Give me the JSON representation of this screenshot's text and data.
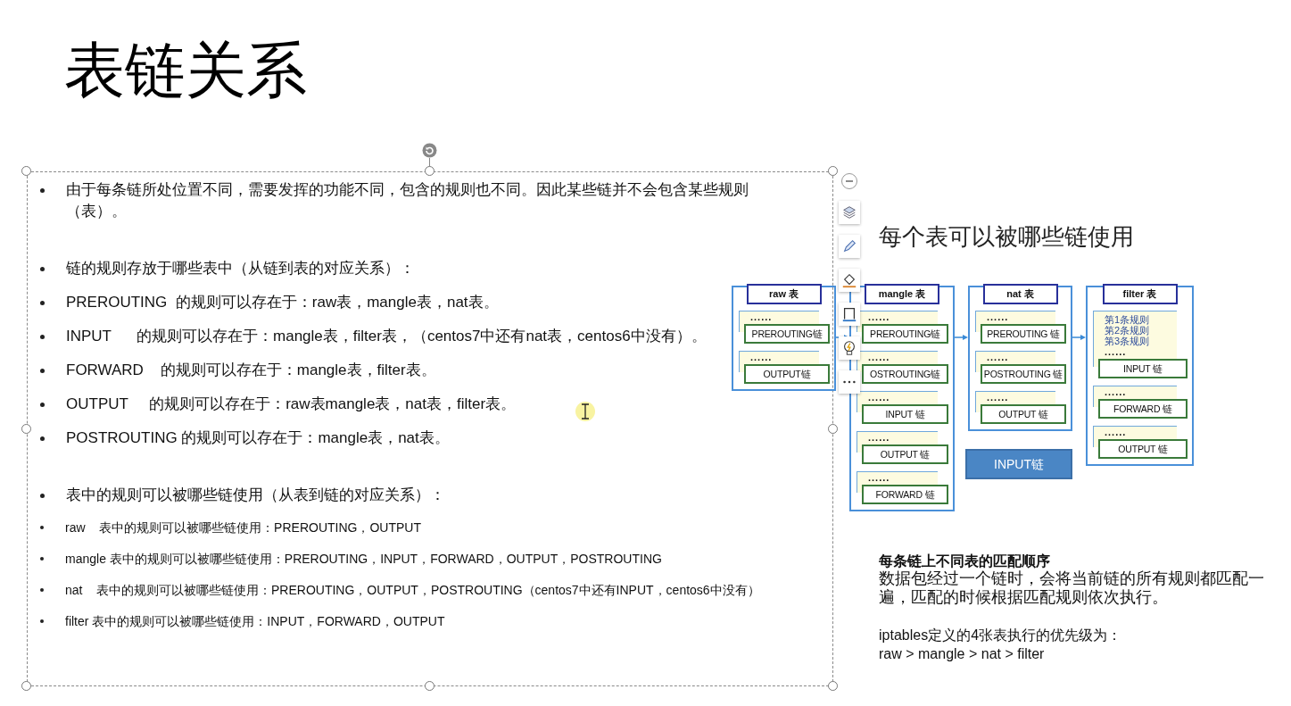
{
  "slide": {
    "title": "表链关系"
  },
  "text_box": {
    "groups": [
      [
        {
          "kind": "main",
          "text": "由于每条链所处位置不同，需要发挥的功能不同，包含的规则也不同。因此某些链并不会包含某些规则（表）。"
        }
      ],
      [
        {
          "kind": "main",
          "text": "链的规则存放于哪些表中（从链到表的对应关系）："
        },
        {
          "kind": "main",
          "text": "PREROUTING  的规则可以存在于：raw表，mangle表，nat表。"
        },
        {
          "kind": "main",
          "text": "INPUT      的规则可以存在于：mangle表，filter表，（centos7中还有nat表，centos6中没有）。"
        },
        {
          "kind": "main",
          "text": "FORWARD    的规则可以存在于：mangle表，filter表。"
        },
        {
          "kind": "main",
          "text": "OUTPUT     的规则可以存在于：raw表mangle表，nat表，filter表。"
        },
        {
          "kind": "main",
          "text": "POSTROUTING 的规则可以存在于：mangle表，nat表。"
        }
      ],
      [
        {
          "kind": "main",
          "text": "表中的规则可以被哪些链使用（从表到链的对应关系）："
        },
        {
          "kind": "sub",
          "text": "raw    表中的规则可以被哪些链使用：PREROUTING，OUTPUT"
        },
        {
          "kind": "sub",
          "text": "mangle 表中的规则可以被哪些链使用：PREROUTING，INPUT，FORWARD，OUTPUT，POSTROUTING"
        },
        {
          "kind": "sub",
          "text": "nat    表中的规则可以被哪些链使用：PREROUTING，OUTPUT，POSTROUTING（centos7中还有INPUT，centos6中没有）"
        },
        {
          "kind": "sub",
          "text": "filter 表中的规则可以被哪些链使用：INPUT，FORWARD，OUTPUT"
        }
      ]
    ]
  },
  "diagram": {
    "heading": "每个表可以被哪些链使用",
    "tables": [
      {
        "name": "raw 表",
        "chains": [
          {
            "dots": "......",
            "label": "PREROUTING链"
          },
          {
            "dots": "......",
            "label": "OUTPUT链"
          }
        ]
      },
      {
        "name": "mangle 表",
        "chains": [
          {
            "dots": "......",
            "label": "PREROUTING链"
          },
          {
            "dots": "......",
            "label": "OSTROUTING链"
          },
          {
            "dots": "......",
            "label": "INPUT 链"
          },
          {
            "dots": "......",
            "label": "OUTPUT 链"
          },
          {
            "dots": "......",
            "label": "FORWARD 链"
          }
        ]
      },
      {
        "name": "nat 表",
        "chains": [
          {
            "dots": "......",
            "label": "PREROUTING 链"
          },
          {
            "dots": "......",
            "label": "POSTROUTING 链"
          },
          {
            "dots": "......",
            "label": "OUTPUT 链"
          }
        ],
        "note_box": "INPUT链"
      },
      {
        "name": "filter 表",
        "chains": [
          {
            "rules": [
              "第1条规则",
              "第2条规则",
              "第3条规则"
            ],
            "dots": "......",
            "label": "INPUT 链"
          },
          {
            "dots": "......",
            "label": "FORWARD 链"
          },
          {
            "dots": "......",
            "label": "OUTPUT 链"
          }
        ]
      }
    ]
  },
  "notes": {
    "heading": "每条链上不同表的匹配顺序",
    "body": "数据包经过一个链时，会将当前链的所有规则都匹配一遍，匹配的时候根据匹配规则依次执行。",
    "lines": [
      "iptables定义的4张表执行的优先级为：",
      "raw > mangle > nat > filter"
    ]
  }
}
